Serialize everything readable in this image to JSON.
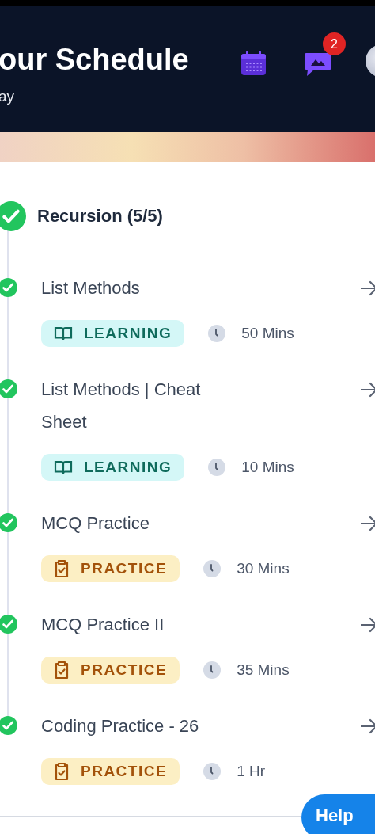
{
  "header": {
    "title": "our Schedule",
    "subtitle": "ay",
    "notification_count": "2"
  },
  "section": {
    "title": "Recursion (5/5)",
    "completed": true
  },
  "items": [
    {
      "title": "List Methods",
      "kind": "learning",
      "tag": "LEARNING",
      "duration": "50 Mins",
      "completed": true
    },
    {
      "title": "List Methods | Cheat Sheet",
      "kind": "learning",
      "tag": "LEARNING",
      "duration": "10 Mins",
      "completed": true
    },
    {
      "title": "MCQ Practice",
      "kind": "practice",
      "tag": "PRACTICE",
      "duration": "30 Mins",
      "completed": true
    },
    {
      "title": "MCQ Practice II",
      "kind": "practice",
      "tag": "PRACTICE",
      "duration": "35 Mins",
      "completed": true
    },
    {
      "title": "Coding Practice - 26",
      "kind": "practice",
      "tag": "PRACTICE",
      "duration": "1 Hr",
      "completed": true
    }
  ],
  "help_button": "Help"
}
